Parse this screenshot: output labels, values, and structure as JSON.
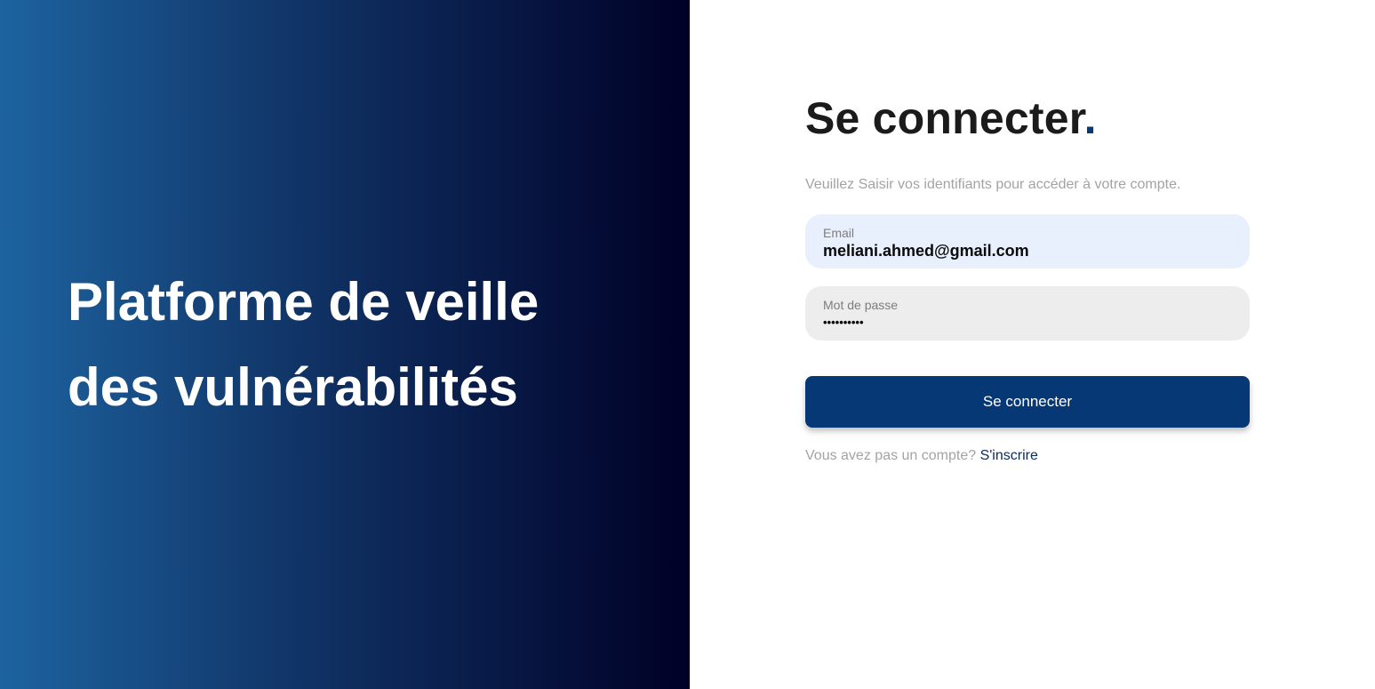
{
  "hero": {
    "title_line1": "Platforme de veille",
    "title_line2": "des vulnérabilités"
  },
  "login": {
    "heading": "Se connecter",
    "heading_dot": ".",
    "subtitle": "Veuillez Saisir vos identifiants pour accéder à votre compte.",
    "email_label": "Email",
    "email_value": "meliani.ahmed@gmail.com",
    "password_label": "Mot de passe",
    "password_value": "••••••••••",
    "submit_label": "Se connecter",
    "signup_prompt": "Vous avez pas un compte?",
    "signup_link": "S'inscrire"
  },
  "colors": {
    "accent": "#053874",
    "hero_gradient_start": "#1d63a0",
    "hero_gradient_end": "#000026",
    "email_field_bg": "#e8f0fe",
    "password_field_bg": "#ededed"
  }
}
